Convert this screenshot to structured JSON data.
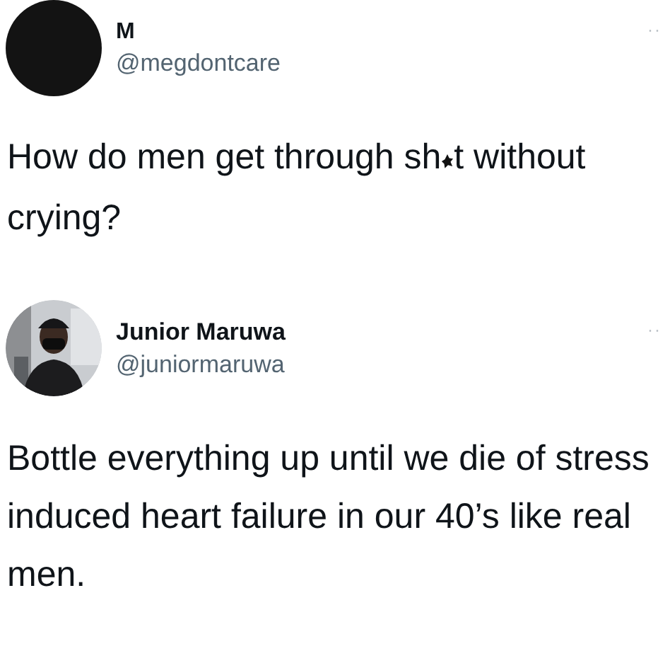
{
  "tweets": [
    {
      "avatar": {
        "kind": "plain"
      },
      "name": "M",
      "handle": "@megdontcare",
      "more": "··",
      "body": [
        {
          "kind": "text",
          "text": "How do men get through sh"
        },
        {
          "kind": "censor"
        },
        {
          "kind": "text",
          "text": "t without crying?"
        }
      ]
    },
    {
      "avatar": {
        "kind": "picture"
      },
      "name": "Junior Maruwa",
      "handle": "@juniormaruwa",
      "more": "··",
      "body": [
        {
          "kind": "text",
          "text": "Bottle everything up until we die of stress induced heart failure in our 40’s like real men."
        }
      ]
    }
  ]
}
